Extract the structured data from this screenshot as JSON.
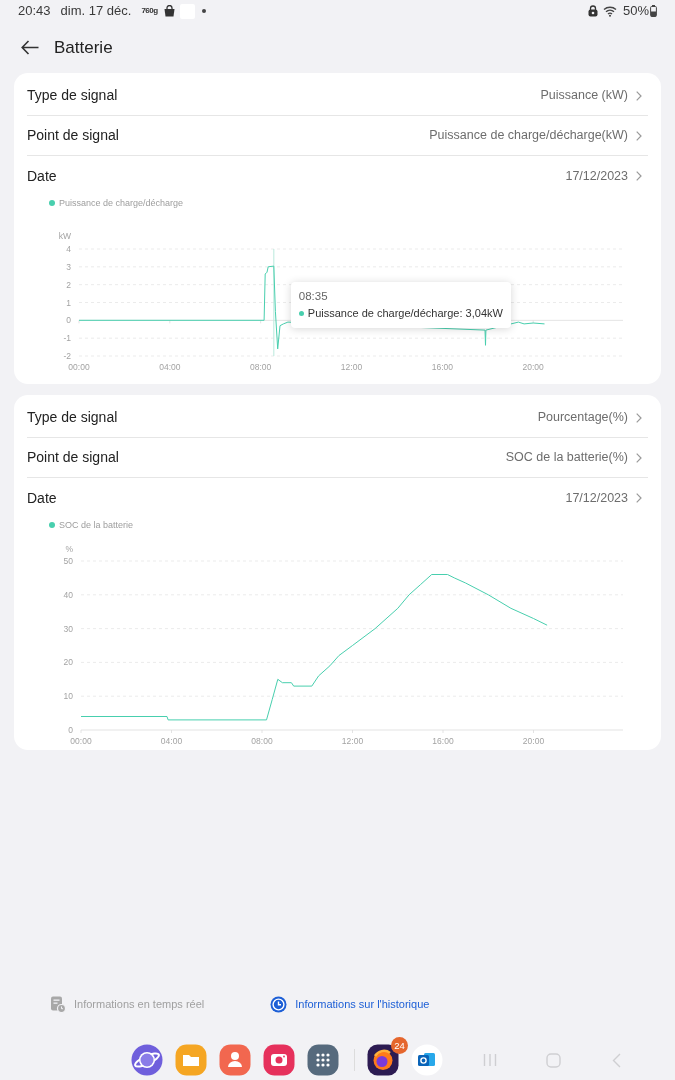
{
  "status_bar": {
    "time": "20:43",
    "date": "dim. 17 déc.",
    "notification": "760g",
    "battery": "50%"
  },
  "header": {
    "title": "Batterie"
  },
  "cards": [
    {
      "rows": [
        {
          "label": "Type de signal",
          "value": "Puissance (kW)"
        },
        {
          "label": "Point de signal",
          "value": "Puissance de charge/décharge(kW)"
        },
        {
          "label": "Date",
          "value": "17/12/2023"
        }
      ],
      "chart_data": {
        "type": "line",
        "ylabel": "kW",
        "x": [
          0,
          8.15,
          8.2,
          8.28,
          8.33,
          8.58,
          8.65,
          8.75,
          8.85,
          9.0,
          9.2,
          17.88,
          17.9,
          17.92,
          19.35,
          19.6,
          20,
          20.5
        ],
        "series": [
          {
            "name": "Puissance de charge/décharge",
            "color": "#48cfae",
            "values": [
              0,
              0,
              2.6,
              2.7,
              3.0,
              3.04,
              0.5,
              -1.6,
              -0.3,
              -0.2,
              -0.1,
              -0.55,
              -1.4,
              -0.55,
              -0.1,
              -0.2,
              -0.15,
              -0.2
            ]
          }
        ],
        "xlim": [
          0,
          24
        ],
        "ylim": [
          -2,
          4
        ],
        "xticks": [
          {
            "value": 0,
            "label": "00:00"
          },
          {
            "value": 4,
            "label": "04:00"
          },
          {
            "value": 8,
            "label": "08:00"
          },
          {
            "value": 12,
            "label": "12:00"
          },
          {
            "value": 16,
            "label": "16:00"
          },
          {
            "value": 20,
            "label": "20:00"
          }
        ],
        "yticks": [
          -2,
          -1,
          0,
          1,
          2,
          3,
          4
        ],
        "grid": true,
        "ref_lines": [
          {
            "axis": "x",
            "value": 8.58
          }
        ]
      },
      "tooltip": {
        "time": "08:35",
        "text": "Puissance de charge/décharge: 3,04kW"
      }
    },
    {
      "rows": [
        {
          "label": "Type de signal",
          "value": "Pourcentage(%)"
        },
        {
          "label": "Point de signal",
          "value": "SOC de la batterie(%)"
        },
        {
          "label": "Date",
          "value": "17/12/2023"
        }
      ],
      "chart_data": {
        "type": "line",
        "ylabel": "%",
        "x": [
          0,
          3.8,
          3.85,
          8.2,
          8.45,
          8.7,
          8.9,
          9.3,
          9.4,
          10.2,
          10.5,
          11,
          11.4,
          12,
          13,
          14,
          14.5,
          15,
          15.5,
          16.2,
          16.5,
          17,
          18,
          19,
          20,
          20.6
        ],
        "series": [
          {
            "name": "SOC de la batterie",
            "color": "#48cfae",
            "values": [
              4,
              4,
              3,
              3,
              9,
              15,
              14,
              14,
              13,
              13,
              16,
              19,
              22,
              25,
              30,
              36,
              40,
              43,
              46,
              46,
              45,
              43.5,
              40,
              36,
              33,
              31
            ]
          }
        ],
        "xlim": [
          0,
          24
        ],
        "ylim": [
          0,
          50
        ],
        "xticks": [
          {
            "value": 0,
            "label": "00:00"
          },
          {
            "value": 4,
            "label": "04:00"
          },
          {
            "value": 8,
            "label": "08:00"
          },
          {
            "value": 12,
            "label": "12:00"
          },
          {
            "value": 16,
            "label": "16:00"
          },
          {
            "value": 20,
            "label": "20:00"
          }
        ],
        "yticks": [
          0,
          10,
          20,
          30,
          40,
          50
        ],
        "grid": true
      }
    }
  ],
  "bottom_tabs": [
    {
      "label": "Informations en temps réel",
      "selected": false
    },
    {
      "label": "Informations sur l'historique",
      "selected": true
    }
  ],
  "dock": {
    "badge": "24"
  }
}
